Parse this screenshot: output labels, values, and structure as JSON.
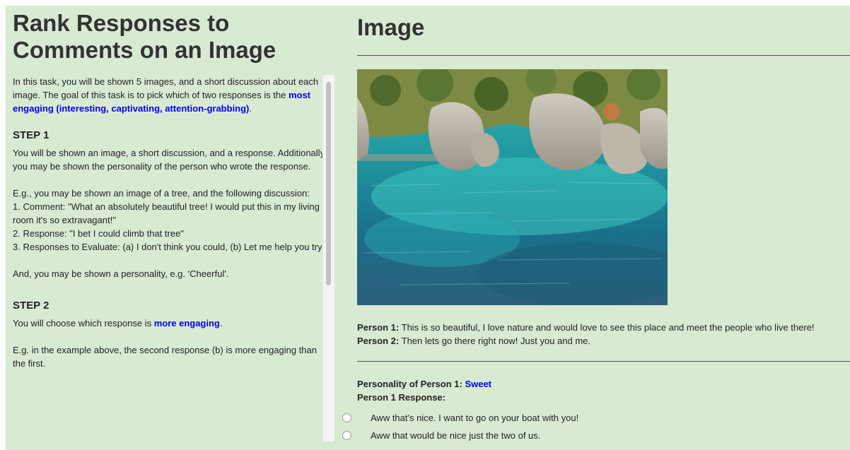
{
  "left": {
    "title_line1": "Rank Responses to",
    "title_line2": "Comments on an Image",
    "intro_text": "In this task, you will be shown 5 images, and a short discussion about each image. The goal of this task is to pick which of two responses is the ",
    "intro_emphasis": "most engaging (interesting, captivating, attention-grabbing)",
    "intro_end": ".",
    "step1_heading": "STEP 1",
    "step1_p1": "You will be shown an image, a short discussion, and a response. Additionally, you may be shown the personality of the person who wrote the response.",
    "step1_eg_intro": "E.g., you may be shown an image of a tree, and the following discussion:",
    "step1_eg_1": "1. Comment: \"What an absolutely beautiful tree! I would put this in my living room it's so extravagant!\"",
    "step1_eg_2": "2. Response: \"I bet I could climb that tree\"",
    "step1_eg_3": "3. Responses to Evaluate: (a) I don't think you could, (b) Let me help you try!",
    "step1_personality": "And, you may be shown a personality, e.g. 'Cheerful'.",
    "step2_heading": "STEP 2",
    "step2_text": "You will choose which response is ",
    "step2_emphasis": "more engaging",
    "step2_end": ".",
    "step2_eg": "E.g. in the example above, the second response (b) is more engaging than the first."
  },
  "right": {
    "title": "Image",
    "person1_label": "Person 1:",
    "person1_text": " This is so beautiful, I love nature and would love to see this place and meet the people who live there!",
    "person2_label": "Person 2:",
    "person2_text": " Then lets go there right now! Just you and me.",
    "personality_label": "Personality of Person 1: ",
    "personality_value": "Sweet",
    "response_label": "Person 1 Response:",
    "responses": [
      "Aww that's nice. I want to go on your boat with you!",
      "Aww that would be nice just the two of us."
    ]
  },
  "colors": {
    "panel_bg": "#d9ead3",
    "emphasis_blue": "#0000ee"
  }
}
